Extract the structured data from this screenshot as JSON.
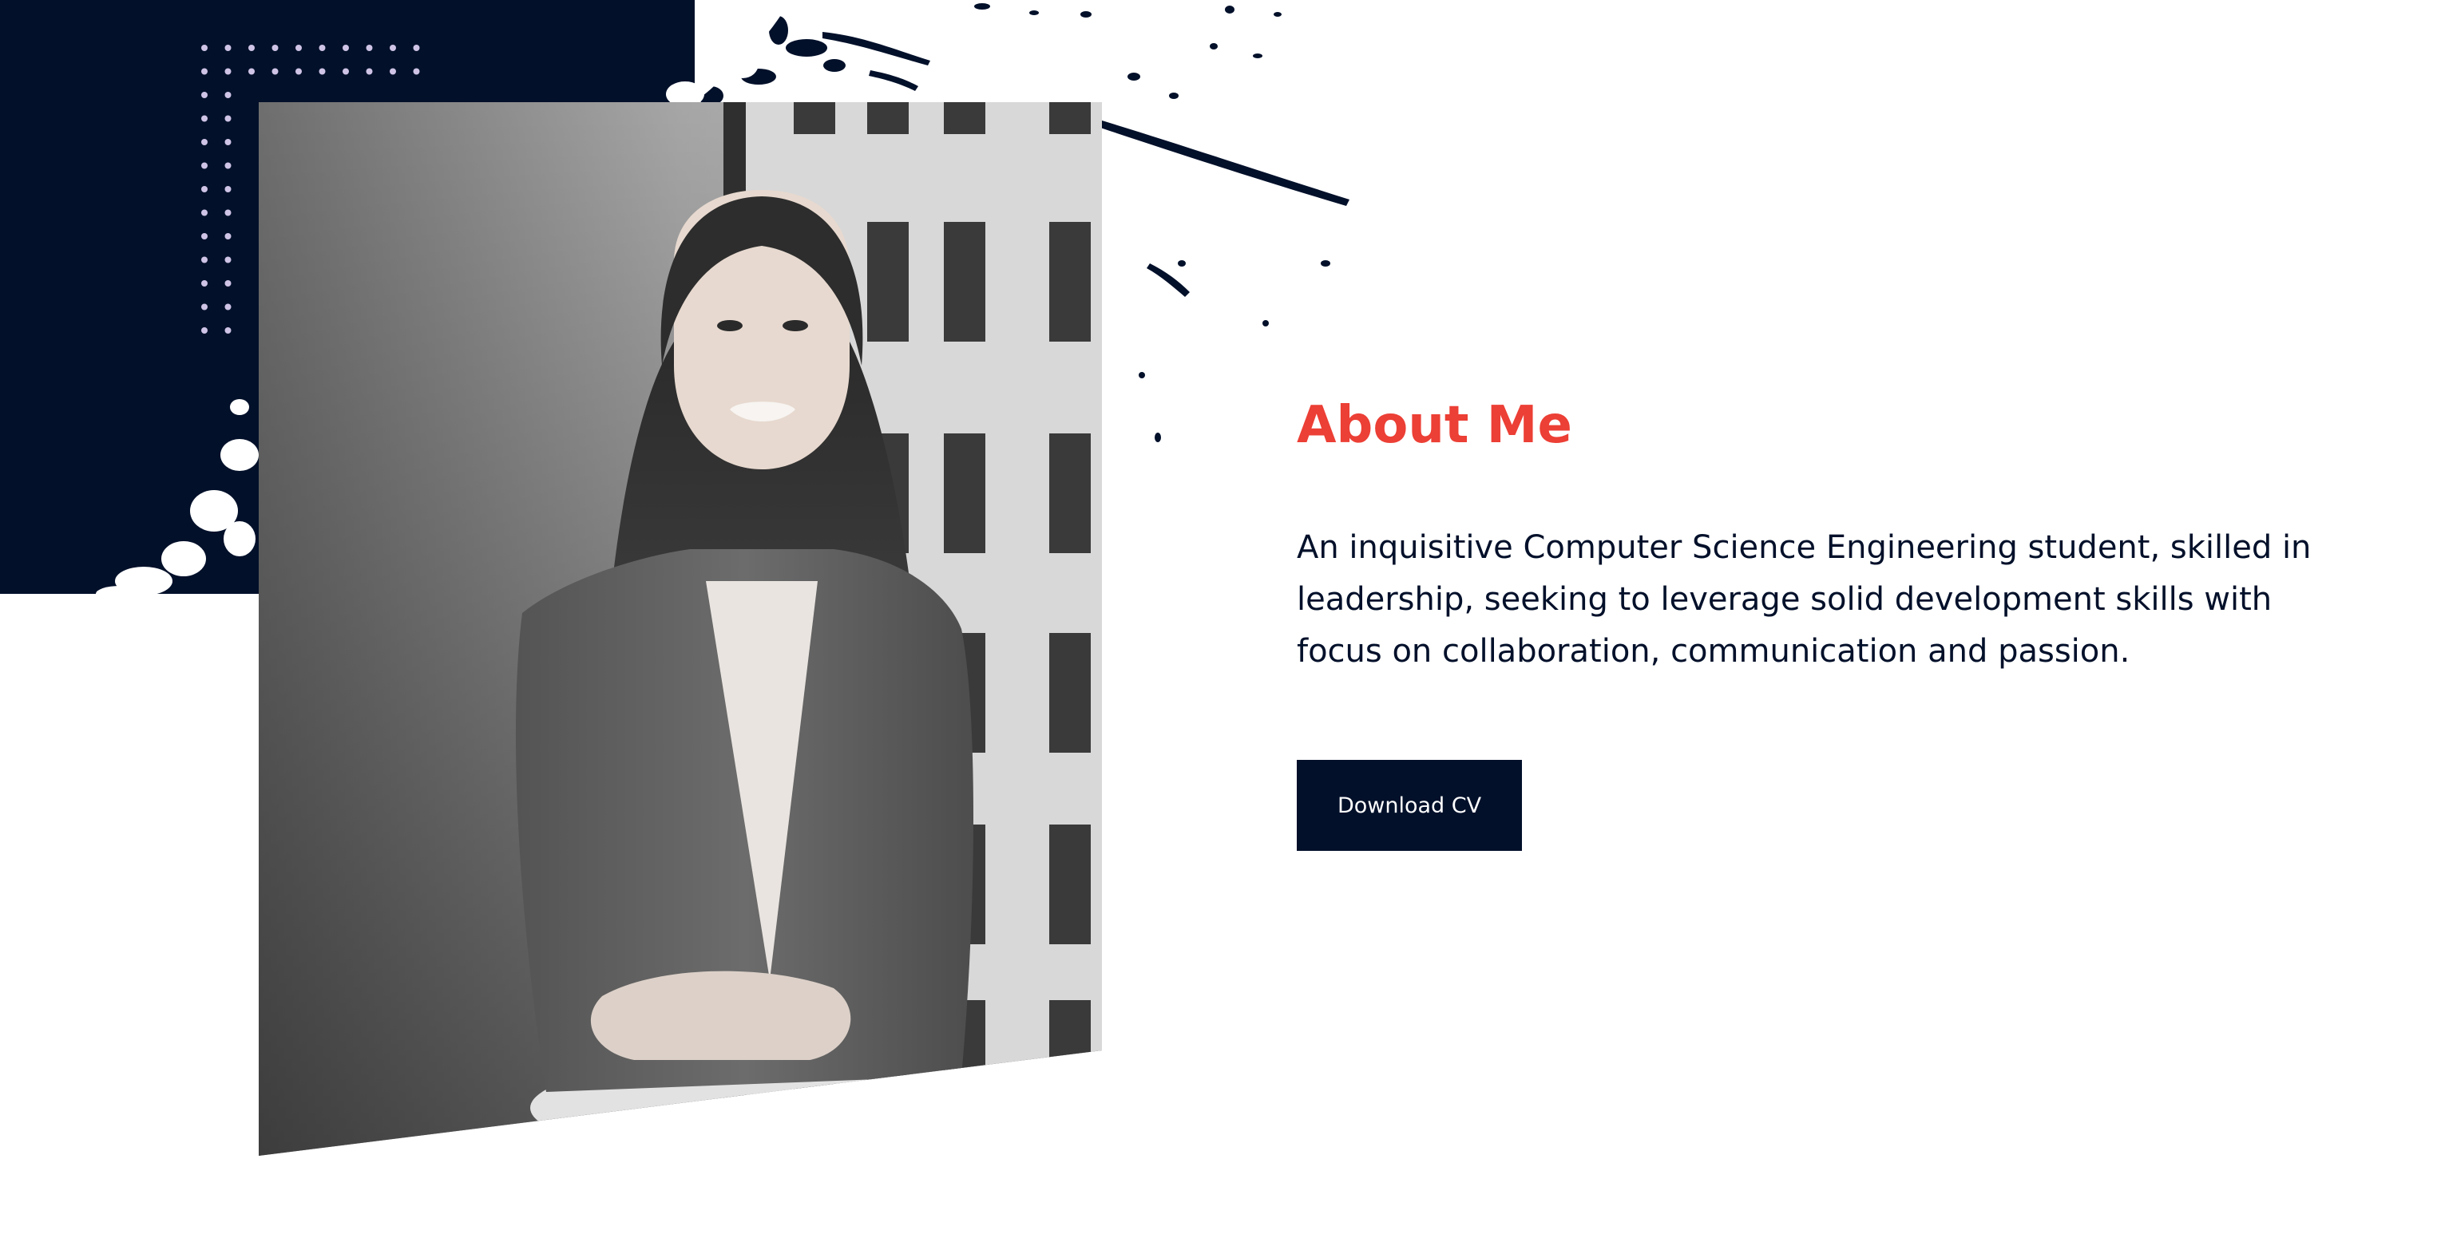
{
  "about": {
    "heading": "About Me",
    "paragraph": "An inquisitive Computer Science Engineering student, skilled in leadership, seeking to leverage solid development skills with focus on collaboration, communication and passion.",
    "cv_button_label": "Download CV"
  },
  "colors": {
    "accent": "#ec3f35",
    "navy": "#02102a",
    "background": "#ffffff"
  },
  "images": {
    "portrait": "profile-portrait",
    "decoration": "ink-splatter"
  }
}
